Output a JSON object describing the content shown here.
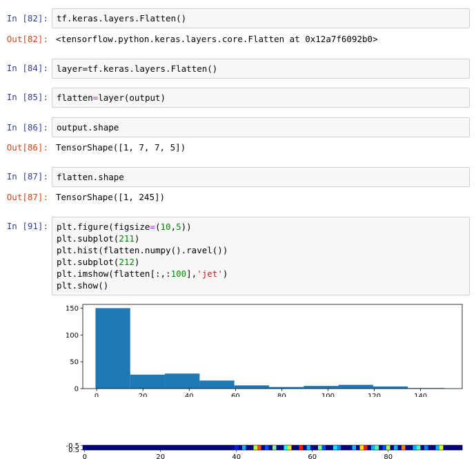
{
  "cells": [
    {
      "in_prompt": "In [82]:",
      "code": "tf.keras.layers.Flatten()",
      "out_prompt": "Out[82]:",
      "output": "<tensorflow.python.keras.layers.core.Flatten at 0x12a7f6092b0>"
    },
    {
      "in_prompt": "In [84]:",
      "code": "layer=tf.keras.layers.Flatten()"
    },
    {
      "in_prompt": "In [85]:",
      "code_parts": [
        "flatten",
        "=",
        "layer(output)"
      ]
    },
    {
      "in_prompt": "In [86]:",
      "code": "output.shape",
      "out_prompt": "Out[86]:",
      "output": "TensorShape([1, 7, 7, 5])"
    },
    {
      "in_prompt": "In [87]:",
      "code": "flatten.shape",
      "out_prompt": "Out[87]:",
      "output": "TensorShape([1, 245])"
    },
    {
      "in_prompt": "In [91]:",
      "code_lines": [
        "plt.figure(figsize=(10,5))",
        "plt.subplot(211)",
        "plt.hist(flatten.numpy().ravel())",
        "plt.subplot(212)",
        "plt.imshow(flatten[:,:100],'jet')",
        "plt.show()"
      ]
    }
  ],
  "chart_data": [
    {
      "type": "bar",
      "x_bin_edges": [
        -0.5,
        14.5,
        29.5,
        44.5,
        59.5,
        74.5,
        89.5,
        104.5,
        119.5,
        134.5,
        150.5
      ],
      "values": [
        150,
        26,
        28,
        15,
        6,
        3,
        5,
        7,
        4,
        1
      ],
      "xlim": [
        -6,
        158
      ],
      "ylim": [
        0,
        157
      ],
      "xticks": [
        "0",
        "20",
        "40",
        "60",
        "80",
        "100",
        "120",
        "140"
      ],
      "xtick_values": [
        0,
        20,
        40,
        60,
        80,
        100,
        120,
        140
      ],
      "yticks": [
        "0",
        "50",
        "100",
        "150"
      ],
      "ytick_values": [
        0,
        50,
        100,
        150
      ],
      "bar_color": "#1f77b4"
    },
    {
      "type": "heatmap",
      "colormap": "jet",
      "xticks": [
        "0",
        "20",
        "40",
        "60",
        "80"
      ],
      "xtick_values": [
        0,
        20,
        40,
        60,
        80
      ],
      "yticks": [
        "-0.5",
        "0.5"
      ],
      "n_columns": 100,
      "values": [
        0,
        0,
        0,
        0,
        0,
        0,
        0,
        0,
        0,
        0,
        0,
        0,
        0,
        0,
        0,
        0,
        0,
        0,
        0,
        0,
        0,
        0,
        0,
        0,
        0,
        0,
        0,
        0,
        0,
        0,
        0,
        0,
        0,
        0,
        0,
        0,
        0,
        0,
        0,
        0,
        0.15,
        0,
        0.3,
        0,
        0,
        0.55,
        0.8,
        0,
        0.2,
        0,
        0.5,
        0,
        0,
        0.4,
        0.65,
        0,
        0,
        0.85,
        0,
        0.3,
        0,
        0,
        0.5,
        0.2,
        0,
        0,
        0.35,
        0.25,
        0,
        0,
        0,
        0.3,
        0,
        0.65,
        0.85,
        0,
        0.3,
        0.45,
        0,
        0.2,
        0.55,
        0,
        0.3,
        0,
        0.75,
        0,
        0,
        0.3,
        0.45,
        0,
        0.25,
        0,
        0,
        0.3,
        0.6,
        0,
        0,
        0,
        0,
        0
      ]
    }
  ]
}
